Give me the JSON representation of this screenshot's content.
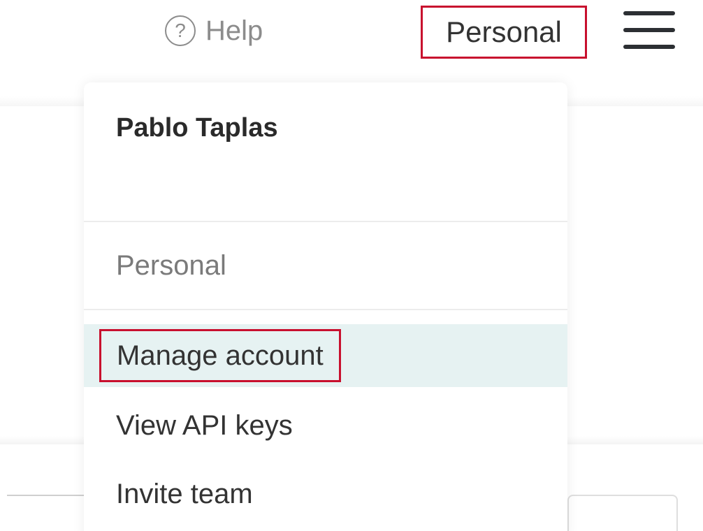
{
  "header": {
    "help_label": "Help",
    "help_icon": "?",
    "org_switcher_label": "Personal"
  },
  "dropdown": {
    "user_name": "Pablo Taplas",
    "current_org": "Personal",
    "items": [
      {
        "label": "Manage account"
      },
      {
        "label": "View API keys"
      },
      {
        "label": "Invite team"
      }
    ]
  },
  "colors": {
    "highlight_outline": "#c8102e",
    "active_item_background": "#e6f2f2"
  }
}
